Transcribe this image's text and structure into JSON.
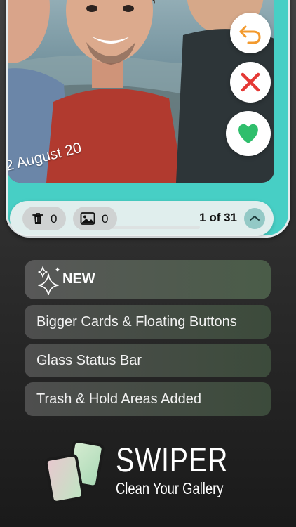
{
  "preview": {
    "date_text": "2 August 20",
    "trash_count": "0",
    "hold_count": "0",
    "counter": "1 of 31"
  },
  "features": {
    "new_label": "NEW",
    "items": [
      {
        "label": "Bigger Cards & Floating Buttons"
      },
      {
        "label": "Glass Status Bar"
      },
      {
        "label": "Trash & Hold Areas Added"
      }
    ]
  },
  "brand": {
    "title": "SWIPER",
    "subtitle": "Clean Your Gallery"
  },
  "icons": {
    "undo": "undo-icon",
    "delete": "close-icon",
    "keep": "heart-icon",
    "trash": "trash-icon",
    "image": "image-icon",
    "chevron": "chevron-up-icon",
    "sparkle": "sparkle-icon"
  },
  "colors": {
    "accent": "#47cfc5",
    "delete": "#e53935",
    "keep": "#2fbe6c",
    "undo": "#f39a2e"
  }
}
